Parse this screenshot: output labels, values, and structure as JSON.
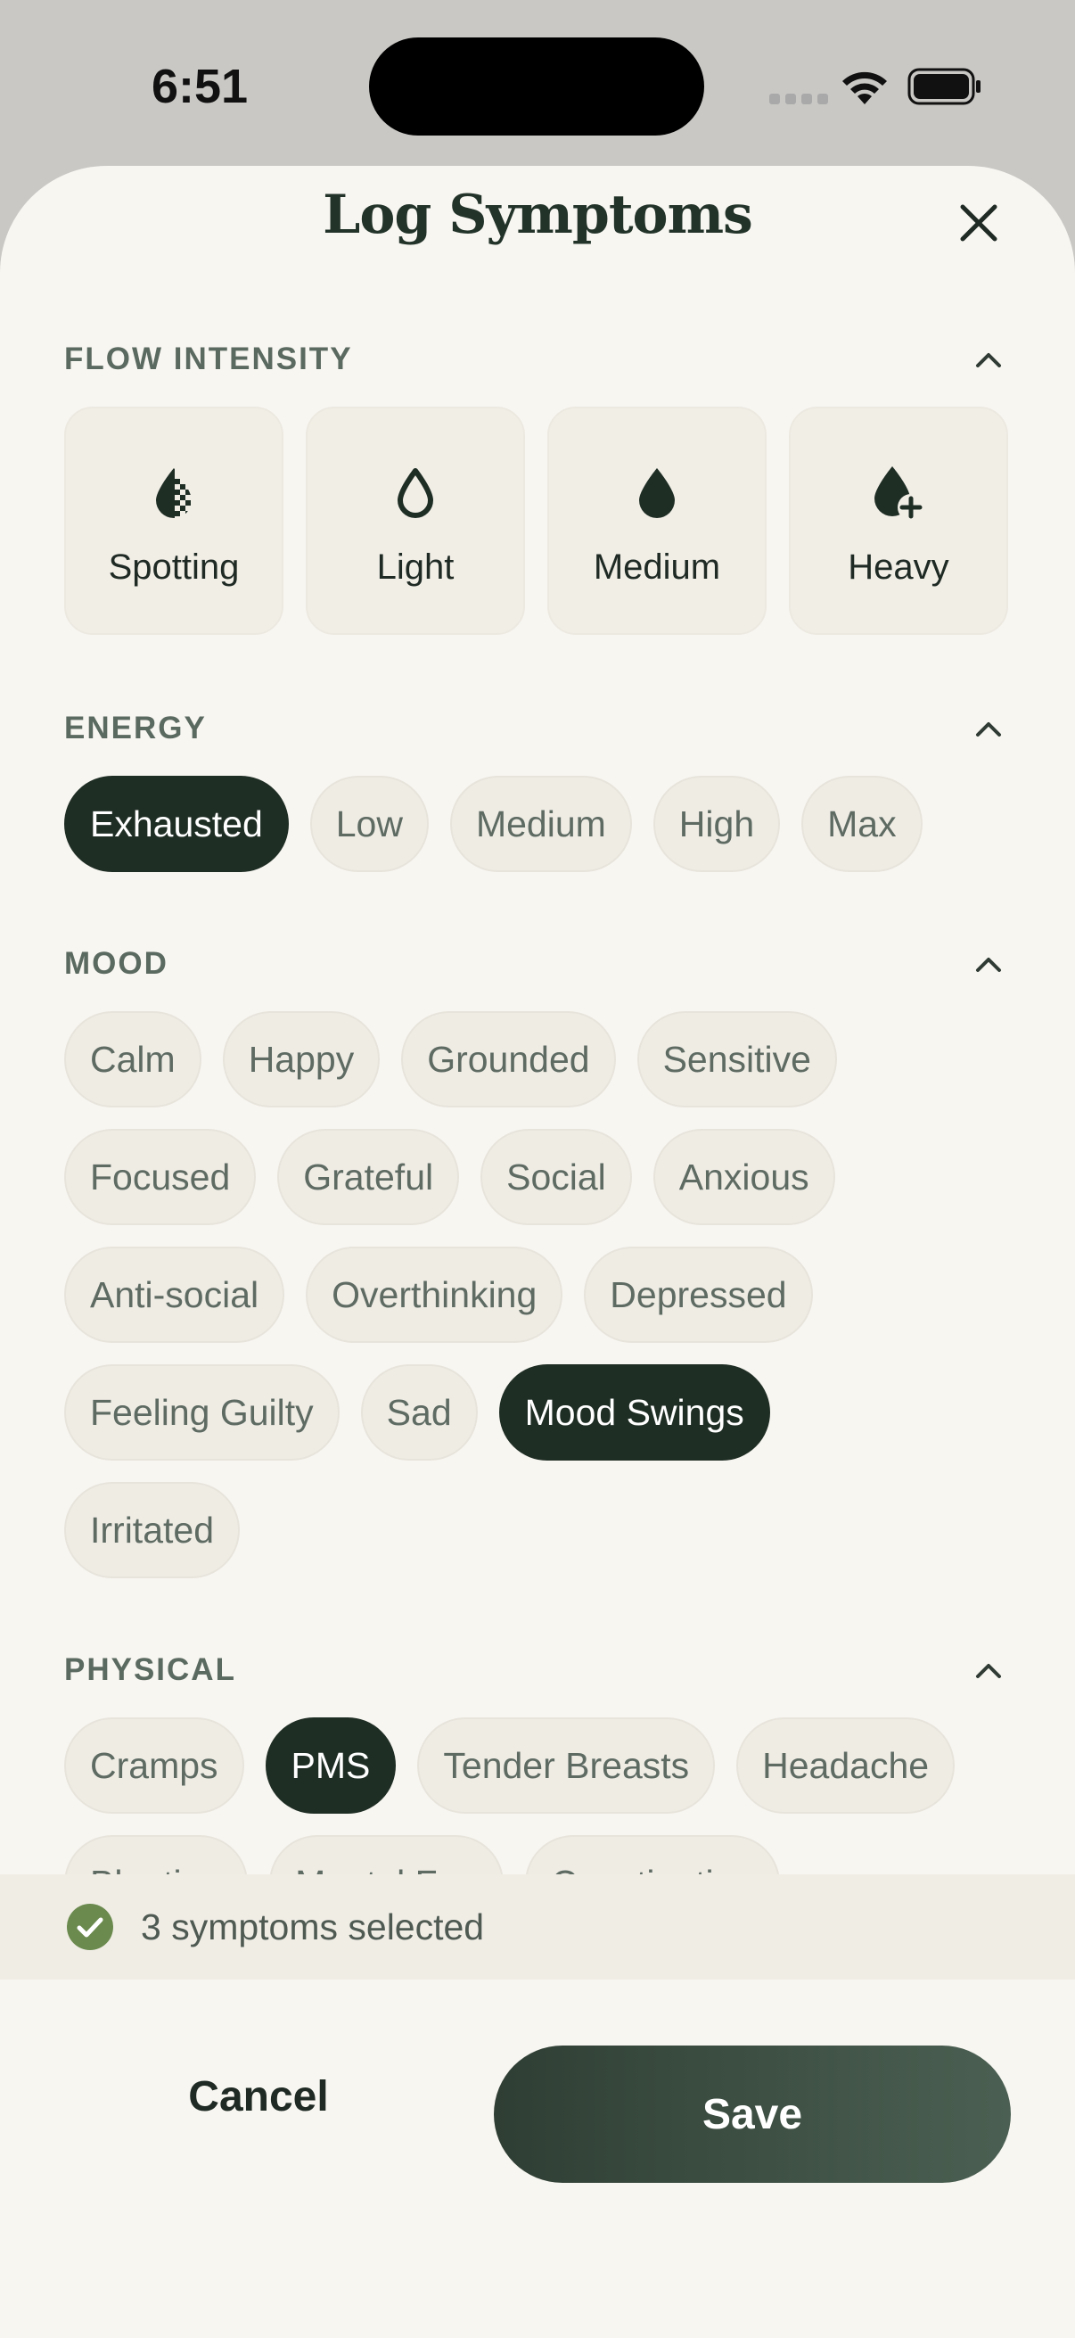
{
  "status_bar": {
    "time": "6:51"
  },
  "sheet": {
    "title": "Log Symptoms"
  },
  "flow": {
    "label": "FLOW INTENSITY",
    "options": [
      {
        "label": "Spotting",
        "icon": "spotting-drop-icon"
      },
      {
        "label": "Light",
        "icon": "light-drop-icon"
      },
      {
        "label": "Medium",
        "icon": "medium-drop-icon"
      },
      {
        "label": "Heavy",
        "icon": "heavy-drop-icon"
      }
    ]
  },
  "energy": {
    "label": "ENERGY",
    "options": [
      "Exhausted",
      "Low",
      "Medium",
      "High",
      "Max"
    ],
    "selected": "Exhausted"
  },
  "mood": {
    "label": "MOOD",
    "options": [
      "Calm",
      "Happy",
      "Grounded",
      "Sensitive",
      "Focused",
      "Grateful",
      "Social",
      "Anxious",
      "Anti-social",
      "Overthinking",
      "Depressed",
      "Feeling Guilty",
      "Sad",
      "Mood Swings",
      "Irritated"
    ],
    "selected": "Mood Swings"
  },
  "physical": {
    "label": "PHYSICAL",
    "options": [
      "Cramps",
      "PMS",
      "Tender Breasts",
      "Headache",
      "Bloating",
      "Mental Fog",
      "Constipation"
    ],
    "selected": "PMS"
  },
  "selection": {
    "text": "3 symptoms selected"
  },
  "actions": {
    "cancel": "Cancel",
    "save": "Save"
  },
  "colors": {
    "accent": "#1f2e25",
    "check": "#6b8a4e",
    "background": "#f8f6f1"
  }
}
